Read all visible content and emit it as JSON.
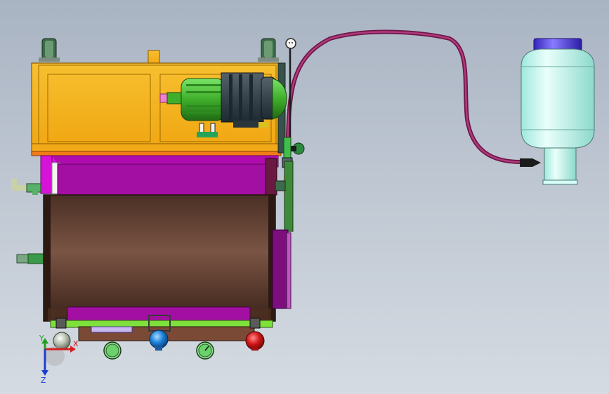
{
  "viewport": {
    "background_top": "#a9b4c3",
    "background_bottom": "#d5dbe2"
  },
  "triad": {
    "x_label": "X",
    "y_label": "Y",
    "z_label": "Z",
    "x_color": "#d42020",
    "y_color": "#1fa01f",
    "z_color": "#1a3fd0"
  },
  "model": {
    "frame_color": "#f5b21b",
    "hopper_color": "#a80ca8",
    "drum_color": "#6e4a38",
    "motor_color": "#48c22e",
    "tank_color": "#c9fbf2",
    "tank_cap_color": "#4a36d8",
    "hose_color": "#8a1f5a"
  }
}
